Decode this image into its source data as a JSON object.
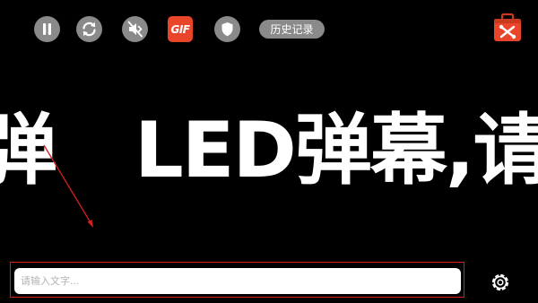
{
  "toolbar": {
    "pause": {
      "icon": "pause-icon"
    },
    "loop": {
      "icon": "loop-icon"
    },
    "sound": {
      "icon": "mute-icon"
    },
    "gif": {
      "label": "GIF",
      "icon": "gif-icon",
      "color": "#e8452a"
    },
    "shield": {
      "icon": "shield-icon"
    },
    "history": {
      "label": "历史记录"
    },
    "toolbox": {
      "icon": "toolbox-icon",
      "color": "#e8452a"
    }
  },
  "marquee": {
    "text": "LED弹幕,请",
    "text_color": "#ffffff",
    "background": "#000000"
  },
  "input": {
    "placeholder": "请输入文字...",
    "value": "",
    "highlight_color": "#d41f1f"
  },
  "settings": {
    "icon": "gear-icon"
  }
}
